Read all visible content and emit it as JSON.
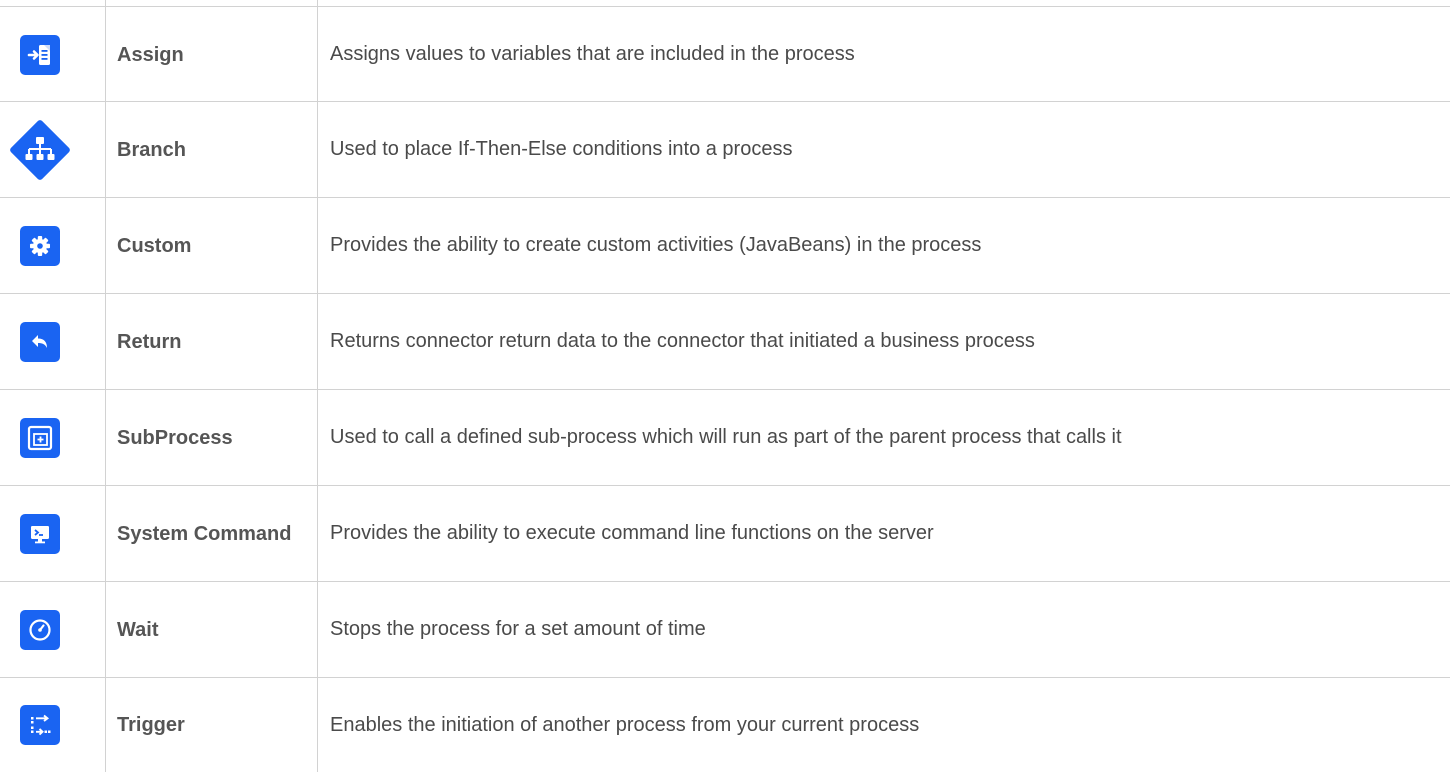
{
  "rows": [
    {
      "icon": "assign-icon",
      "name": "Assign",
      "description": "Assigns values to variables that are included in the process"
    },
    {
      "icon": "branch-icon",
      "name": "Branch",
      "description": "Used to place If-Then-Else conditions into a process"
    },
    {
      "icon": "gear-icon",
      "name": "Custom",
      "description": "Provides the ability to create custom activities (JavaBeans) in the process"
    },
    {
      "icon": "return-arrow-icon",
      "name": "Return",
      "description": "Returns connector return data to the connector that initiated a business process"
    },
    {
      "icon": "subprocess-icon",
      "name": "SubProcess",
      "description": "Used to call a defined sub-process which will run as part of the parent process that calls it"
    },
    {
      "icon": "terminal-monitor-icon",
      "name": "System Command",
      "description": "Provides the ability to execute command line functions on the server"
    },
    {
      "icon": "clock-icon",
      "name": "Wait",
      "description": "Stops the process for a set amount of time"
    },
    {
      "icon": "trigger-icon",
      "name": "Trigger",
      "description": "Enables the initiation of another process from your current process"
    }
  ],
  "colors": {
    "icon_blue": "#1a64f2",
    "border": "#d2d2d2",
    "text": "#4a4a4a"
  }
}
